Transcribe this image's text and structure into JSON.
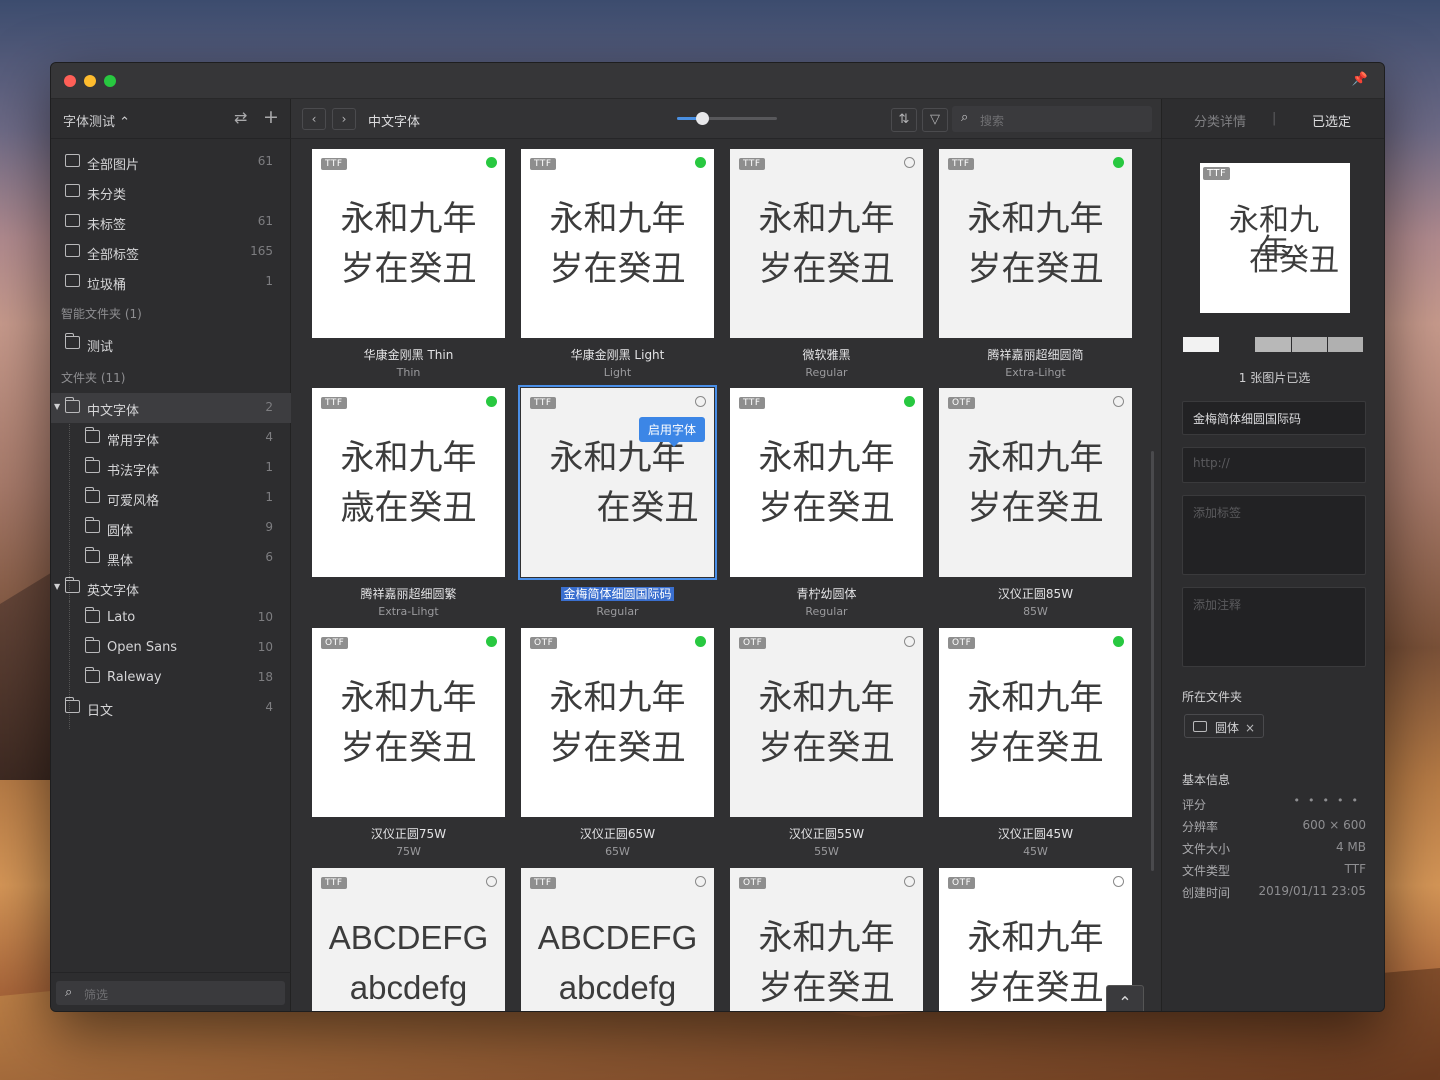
{
  "sidebar": {
    "title": "字体测试 ⌃",
    "swap_icon": "⇄",
    "add_icon": "+",
    "library": [
      {
        "label": "全部图片",
        "count": "61"
      },
      {
        "label": "未分类",
        "count": ""
      },
      {
        "label": "未标签",
        "count": "61"
      },
      {
        "label": "全部标签",
        "count": "165"
      },
      {
        "label": "垃圾桶",
        "count": "1"
      }
    ],
    "smart_section": "智能文件夹 (1)",
    "smart": [
      {
        "label": "测试"
      }
    ],
    "folder_section": "文件夹 (11)",
    "folders": [
      {
        "label": "中文字体",
        "count": "2"
      },
      {
        "label": "常用字体",
        "count": "4"
      },
      {
        "label": "书法字体",
        "count": "1"
      },
      {
        "label": "可爱风格",
        "count": "1"
      },
      {
        "label": "圆体",
        "count": "9"
      },
      {
        "label": "黑体",
        "count": "6"
      },
      {
        "label": "英文字体",
        "count": ""
      },
      {
        "label": "Lato",
        "count": "10"
      },
      {
        "label": "Open Sans",
        "count": "10"
      },
      {
        "label": "Raleway",
        "count": "18"
      },
      {
        "label": "日文",
        "count": "4"
      }
    ],
    "filter_placeholder": "筛选"
  },
  "toolbar": {
    "back": "‹",
    "forward": "›",
    "title": "中文字体",
    "zoom": 0.25,
    "sort_icon": "⇅",
    "filter_icon": "▽",
    "search_placeholder": "搜索"
  },
  "grid": [
    {
      "type": "TTF",
      "active": true,
      "l1": "永和九年",
      "l2": "岁在癸丑",
      "name": "华康金刚黑 Thin",
      "sub": "Thin",
      "white": true
    },
    {
      "type": "TTF",
      "active": true,
      "l1": "永和九年",
      "l2": "岁在癸丑",
      "name": "华康金刚黑 Light",
      "sub": "Light",
      "white": true
    },
    {
      "type": "TTF",
      "active": false,
      "l1": "永和九年",
      "l2": "岁在癸丑",
      "name": "微软雅黑",
      "sub": "Regular",
      "white": false
    },
    {
      "type": "TTF",
      "active": true,
      "l1": "永和九年",
      "l2": "岁在癸丑",
      "name": "腾祥嘉丽超细圆简",
      "sub": "Extra-Lihgt",
      "white": false
    },
    {
      "type": "TTF",
      "active": true,
      "l1": "永和九年",
      "l2": "歳在癸丑",
      "name": "腾祥嘉丽超细圆繁",
      "sub": "Extra-Lihgt",
      "white": true
    },
    {
      "type": "TTF",
      "active": false,
      "l1": "永和九年",
      "l2": "在癸丑",
      "name": "金梅简体细圆国际码",
      "sub": "Regular",
      "white": false,
      "selected": true
    },
    {
      "type": "TTF",
      "active": true,
      "l1": "永和九年",
      "l2": "岁在癸丑",
      "name": "青柠幼圆体",
      "sub": "Regular",
      "white": true
    },
    {
      "type": "OTF",
      "active": false,
      "l1": "永和九年",
      "l2": "岁在癸丑",
      "name": "汉仪正圆85W",
      "sub": "85W",
      "white": false
    },
    {
      "type": "OTF",
      "active": true,
      "l1": "永和九年",
      "l2": "岁在癸丑",
      "name": "汉仪正圆75W",
      "sub": "75W",
      "white": true
    },
    {
      "type": "OTF",
      "active": true,
      "l1": "永和九年",
      "l2": "岁在癸丑",
      "name": "汉仪正圆65W",
      "sub": "65W",
      "white": true
    },
    {
      "type": "OTF",
      "active": false,
      "l1": "永和九年",
      "l2": "岁在癸丑",
      "name": "汉仪正圆55W",
      "sub": "55W",
      "white": false
    },
    {
      "type": "OTF",
      "active": true,
      "l1": "永和九年",
      "l2": "岁在癸丑",
      "name": "汉仪正圆45W",
      "sub": "45W",
      "white": true
    },
    {
      "type": "TTF",
      "active": false,
      "l1": "ABCDEFG",
      "l2": "abcdefg",
      "name": "",
      "sub": "",
      "white": false,
      "en": true
    },
    {
      "type": "TTF",
      "active": false,
      "l1": "ABCDEFG",
      "l2": "abcdefg",
      "name": "",
      "sub": "",
      "white": false,
      "en": true
    },
    {
      "type": "OTF",
      "active": false,
      "l1": "永和九年",
      "l2": "岁在癸丑",
      "name": "",
      "sub": "",
      "white": false
    },
    {
      "type": "OTF",
      "active": false,
      "l1": "永和九年",
      "l2": "岁在癸丑",
      "name": "",
      "sub": "",
      "white": true
    }
  ],
  "enable_tooltip": "启用字体",
  "scroll_top_icon": "⌃",
  "panel": {
    "tab_details": "分类详情",
    "tab_selected": "已选定",
    "preview_type": "TTF",
    "preview_l1": "永和九年",
    "preview_l2": "在癸丑",
    "swatches": [
      "#f2f2f2",
      "#b8b8b8",
      "#b3b3b3",
      "#b0b0b0"
    ],
    "count_text": "1 张图片已选",
    "name_value": "金梅简体细圆国际码",
    "url_placeholder": "http://",
    "tag_placeholder": "添加标签",
    "note_placeholder": "添加注释",
    "folder_label": "所在文件夹",
    "folder_chip": "圆体",
    "info_label": "基本信息",
    "info": [
      {
        "k": "评分",
        "v": ""
      },
      {
        "k": "分辨率",
        "v": "600 × 600"
      },
      {
        "k": "文件大小",
        "v": "4 MB"
      },
      {
        "k": "文件类型",
        "v": "TTF"
      },
      {
        "k": "创建时间",
        "v": "2019/01/11 23:05"
      }
    ],
    "rating_dots": "•••••"
  }
}
